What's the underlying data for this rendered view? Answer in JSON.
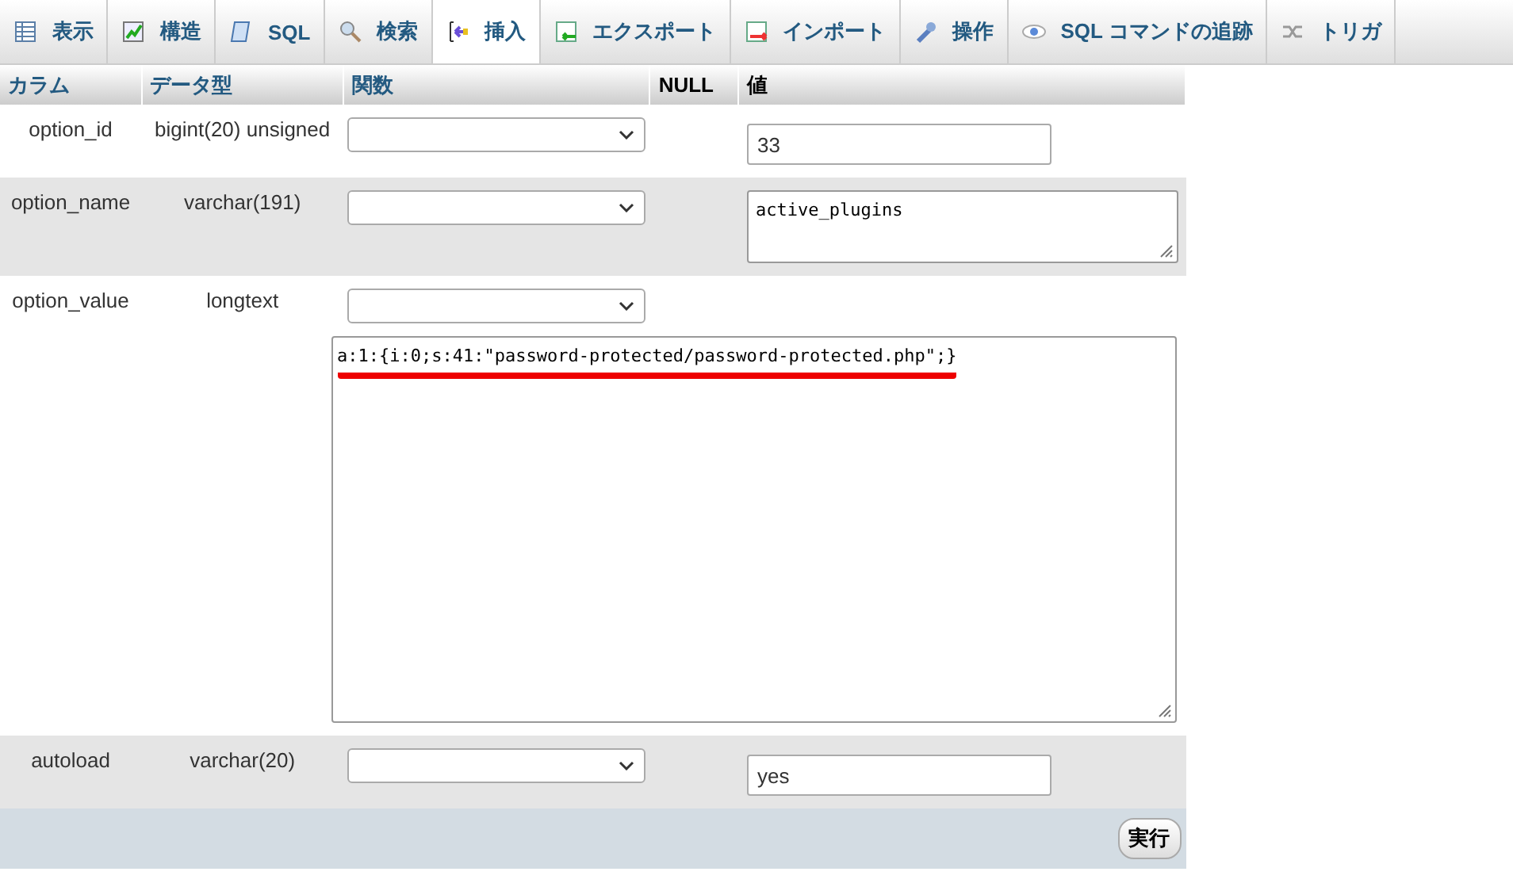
{
  "tabs": [
    {
      "label": "表示",
      "selected": false
    },
    {
      "label": "構造",
      "selected": false
    },
    {
      "label": "SQL",
      "selected": false
    },
    {
      "label": "検索",
      "selected": false
    },
    {
      "label": "挿入",
      "selected": true
    },
    {
      "label": "エクスポート",
      "selected": false
    },
    {
      "label": "インポート",
      "selected": false
    },
    {
      "label": "操作",
      "selected": false
    },
    {
      "label": "SQL コマンドの追跡",
      "selected": false
    },
    {
      "label": "トリガ",
      "selected": false
    }
  ],
  "table": {
    "columns": [
      "カラム",
      "データ型",
      "関数",
      "NULL",
      "値"
    ],
    "rows": [
      {
        "column": "option_id",
        "type": "bigint(20) unsigned",
        "field": {
          "kind": "input",
          "value": "33"
        }
      },
      {
        "column": "option_name",
        "type": "varchar(191)",
        "field": {
          "kind": "textarea",
          "value": "active_plugins"
        }
      },
      {
        "column": "option_value",
        "type": "longtext",
        "field": {
          "kind": "bigtext",
          "value": "a:1:{i:0;s:41:\"password-protected/password-protected.php\";}",
          "highlighted": true
        }
      },
      {
        "column": "autoload",
        "type": "varchar(20)",
        "field": {
          "kind": "input",
          "value": "yes"
        }
      }
    ]
  },
  "submit_button": "実行"
}
